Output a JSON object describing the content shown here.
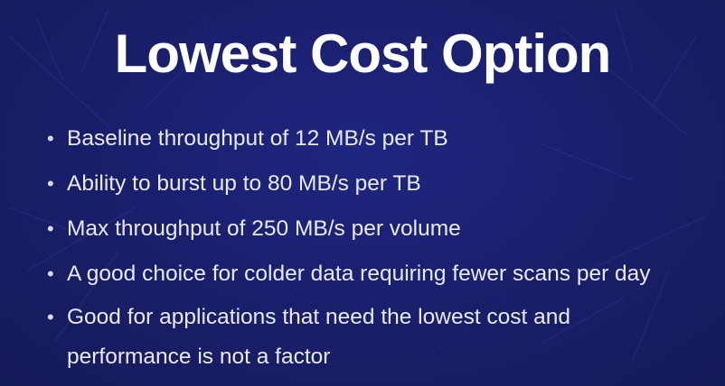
{
  "slide": {
    "title": "Lowest Cost Option",
    "bullet_glyph": "•",
    "bullets": [
      "Baseline throughput of 12 MB/s per TB",
      "Ability to burst up to 80 MB/s per TB",
      "Max throughput of 250 MB/s per volume",
      "A good choice for colder data requiring fewer scans per day",
      "Good for applications that need the lowest cost and performance is not a factor"
    ]
  },
  "colors": {
    "background": "#1a1f6d",
    "title": "#ffffff",
    "text": "#e9eaf6"
  }
}
